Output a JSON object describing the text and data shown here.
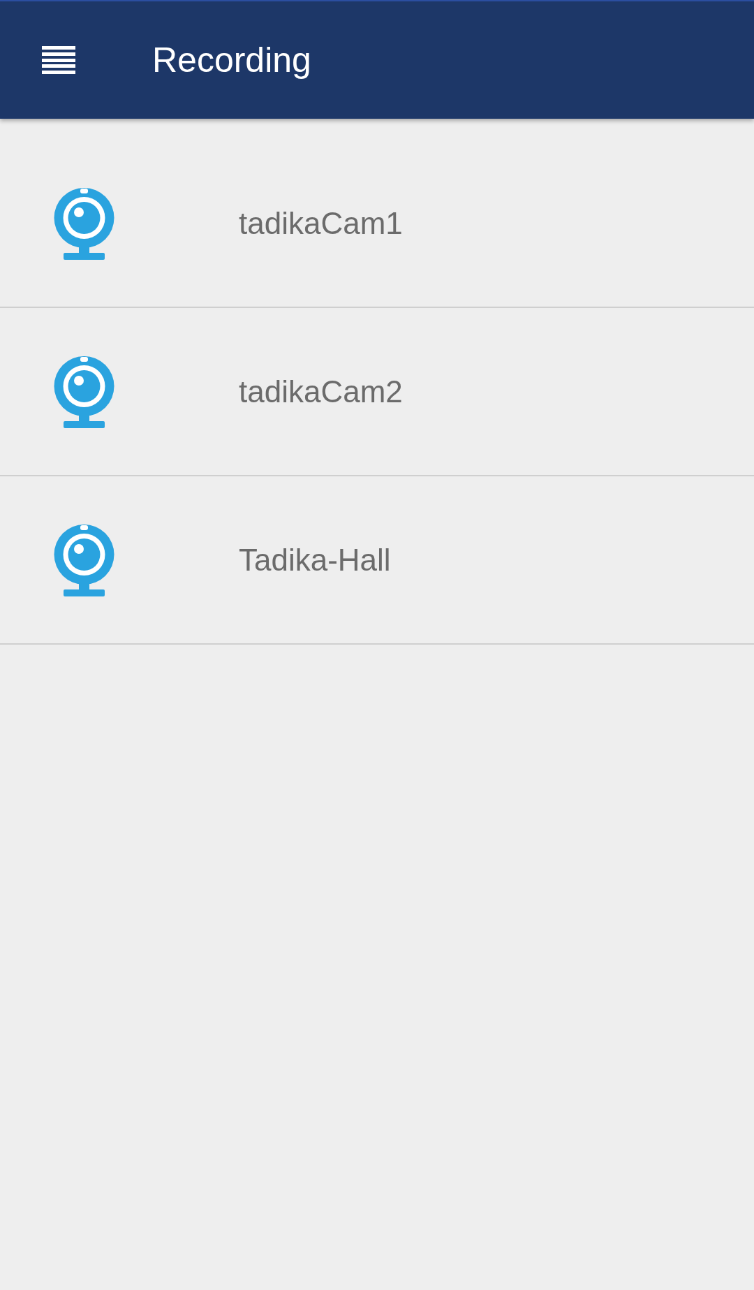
{
  "app_bar": {
    "title": "Recording"
  },
  "cameras": [
    {
      "name": "tadikaCam1"
    },
    {
      "name": "tadikaCam2"
    },
    {
      "name": "Tadika-Hall"
    }
  ]
}
